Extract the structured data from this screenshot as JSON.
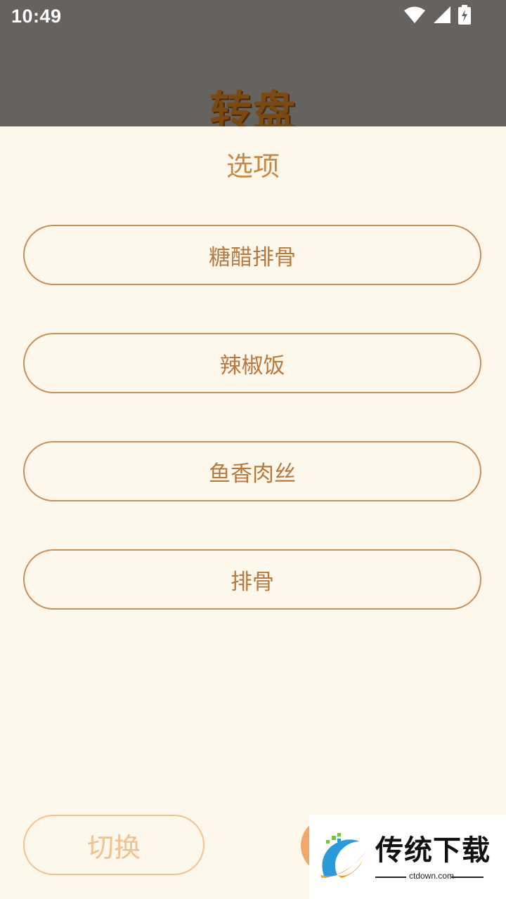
{
  "status_bar": {
    "time": "10:49",
    "icons": [
      "wifi-icon",
      "cell-signal-icon",
      "battery-charging-icon"
    ]
  },
  "background": {
    "title": "转盘"
  },
  "sheet": {
    "title": "选项",
    "options": [
      {
        "label": "糖醋排骨"
      },
      {
        "label": "辣椒饭"
      },
      {
        "label": "鱼香肉丝"
      },
      {
        "label": "排骨"
      }
    ],
    "switch_label": "切换"
  },
  "watermark": {
    "brand": "传统下载",
    "site": "ctdown.com"
  },
  "colors": {
    "sheet_bg": "#fef7ec",
    "accent": "#c68948",
    "scrim": "#666260"
  }
}
